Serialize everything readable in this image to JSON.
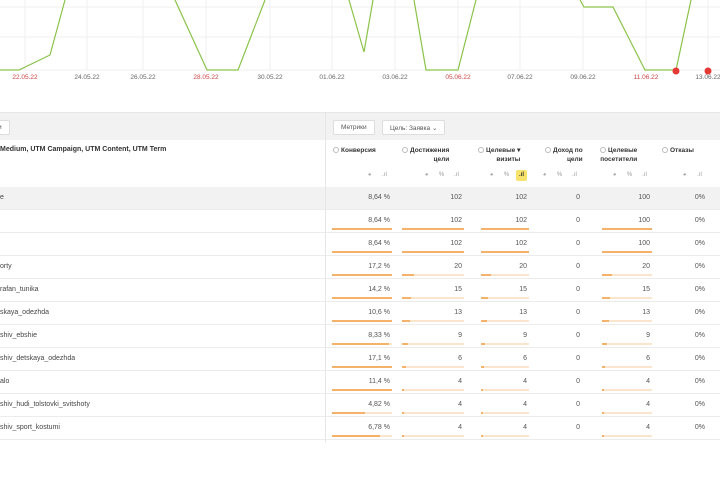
{
  "chart": {
    "x_labels": [
      {
        "text": "22.05.22",
        "weekend": true
      },
      {
        "text": "24.05.22",
        "weekend": false
      },
      {
        "text": "26.05.22",
        "weekend": false
      },
      {
        "text": "28.05.22",
        "weekend": true
      },
      {
        "text": "30.05.22",
        "weekend": false
      },
      {
        "text": "01.06.22",
        "weekend": false
      },
      {
        "text": "03.06.22",
        "weekend": false
      },
      {
        "text": "05.06.22",
        "weekend": true
      },
      {
        "text": "07.06.22",
        "weekend": false
      },
      {
        "text": "09.06.22",
        "weekend": false
      },
      {
        "text": "11.06.22",
        "weekend": true
      },
      {
        "text": "13.06.22",
        "weekend": false
      }
    ],
    "line_color": "#8bc34a",
    "marker_color": "#e53935"
  },
  "toolbar": {
    "left_button": "и",
    "metrics_button": "Метрики",
    "goal_select": "Цель: Заявка"
  },
  "table": {
    "dimension_header": "Medium, UTM Campaign, UTM Content, UTM Term",
    "columns": [
      {
        "l1": "Конверсия",
        "l2": ""
      },
      {
        "l1": "Достижения",
        "l2": "цели"
      },
      {
        "l1": "Целевые ▾",
        "l2": "визиты"
      },
      {
        "l1": "Доход по",
        "l2": "цели"
      },
      {
        "l1": "Целевые",
        "l2": "посетители"
      },
      {
        "l1": "Отказы",
        "l2": ""
      }
    ],
    "rows": [
      {
        "dim": "е",
        "v": [
          "8,64 %",
          "102",
          "102",
          "0",
          "100",
          "0%"
        ],
        "f": [
          1,
          1,
          1,
          0,
          1
        ],
        "total": true
      },
      {
        "dim": "",
        "v": [
          "8,64 %",
          "102",
          "102",
          "0",
          "100",
          "0%"
        ],
        "f": [
          1,
          1,
          1,
          0,
          1
        ]
      },
      {
        "dim": "",
        "v": [
          "8,64 %",
          "102",
          "102",
          "0",
          "100",
          "0%"
        ],
        "f": [
          1,
          1,
          1,
          0,
          1
        ]
      },
      {
        "dim": "orty",
        "v": [
          "17,2 %",
          "20",
          "20",
          "0",
          "20",
          "0%"
        ],
        "f": [
          1,
          0.2,
          0.2,
          0,
          0.2
        ]
      },
      {
        "dim": "rafan_tunika",
        "v": [
          "14,2 %",
          "15",
          "15",
          "0",
          "15",
          "0%"
        ],
        "f": [
          1,
          0.15,
          0.15,
          0,
          0.15
        ]
      },
      {
        "dim": "skaya_odezhda",
        "v": [
          "10,6 %",
          "13",
          "13",
          "0",
          "13",
          "0%"
        ],
        "f": [
          1,
          0.13,
          0.13,
          0,
          0.13
        ]
      },
      {
        "dim": "shiv_ebshie",
        "v": [
          "8,33 %",
          "9",
          "9",
          "0",
          "9",
          "0%"
        ],
        "f": [
          0.95,
          0.09,
          0.09,
          0,
          0.09
        ]
      },
      {
        "dim": "shiv_detskaya_odezhda",
        "v": [
          "17,1 %",
          "6",
          "6",
          "0",
          "6",
          "0%"
        ],
        "f": [
          1,
          0.06,
          0.06,
          0,
          0.06
        ]
      },
      {
        "dim": "alo",
        "v": [
          "11,4 %",
          "4",
          "4",
          "0",
          "4",
          "0%"
        ],
        "f": [
          1,
          0.04,
          0.04,
          0,
          0.04
        ]
      },
      {
        "dim": "shiv_hudi_tolstovki_svitshoty",
        "v": [
          "4,82 %",
          "4",
          "4",
          "0",
          "4",
          "0%"
        ],
        "f": [
          0.55,
          0.04,
          0.04,
          0,
          0.04
        ]
      },
      {
        "dim": "shiv_sport_kostumi",
        "v": [
          "6,78 %",
          "4",
          "4",
          "0",
          "4",
          "0%"
        ],
        "f": [
          0.8,
          0.04,
          0.04,
          0,
          0.04
        ]
      }
    ]
  }
}
